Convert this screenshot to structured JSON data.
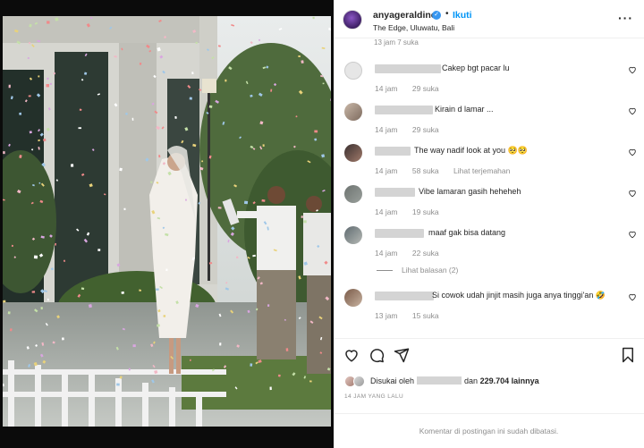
{
  "post": {
    "username": "anyageraldine",
    "verified_icon": "verified-badge-icon",
    "separator": "•",
    "follow_label": "Ikuti",
    "location": "The Edge, Uluwatu, Bali",
    "more_icon": "more-options-icon",
    "more_label": "···"
  },
  "comments": {
    "cut_off_meta": "13 jam   7 suka",
    "items": [
      {
        "name_width": 68,
        "text": "Cakep bgt pacar lu",
        "time": "14 jam",
        "likes": "29 suka",
        "translate": ""
      },
      {
        "name_width": 58,
        "text": "Kirain d lamar ...",
        "time": "14 jam",
        "likes": "29 suka",
        "translate": ""
      },
      {
        "name_width": 40,
        "text": "The way nadif look at you 🥺🥺",
        "time": "14 jam",
        "likes": "58 suka",
        "translate": "Lihat terjemahan"
      },
      {
        "name_width": 46,
        "text": "Vibe lamaran gasih heheheh",
        "time": "14 jam",
        "likes": "19 suka",
        "translate": ""
      },
      {
        "name_width": 58,
        "text": "maaf gak bisa datang",
        "time": "14 jam",
        "likes": "22 suka",
        "translate": ""
      },
      {
        "name_width": 66,
        "text": "Si cowok udah jinjit masih juga anya tinggi'an 🤣",
        "time": "13 jam",
        "likes": "15 suka",
        "translate": ""
      }
    ],
    "view_replies": "Lihat balasan (2)"
  },
  "actions": {
    "like_icon": "heart-icon",
    "comment_icon": "comment-icon",
    "share_icon": "share-icon",
    "save_icon": "bookmark-icon",
    "liked_prefix": "Disukai oleh",
    "liked_mid": "dan",
    "liked_count": "229.704 lainnya",
    "time_ago": "14 JAM YANG LALU",
    "comments_closed": "Komentar di postingan ini sudah dibatasi."
  },
  "colors": {
    "accent": "#0095f6",
    "verified": "#3897f0",
    "muted": "#8e8e8e",
    "text": "#262626"
  }
}
